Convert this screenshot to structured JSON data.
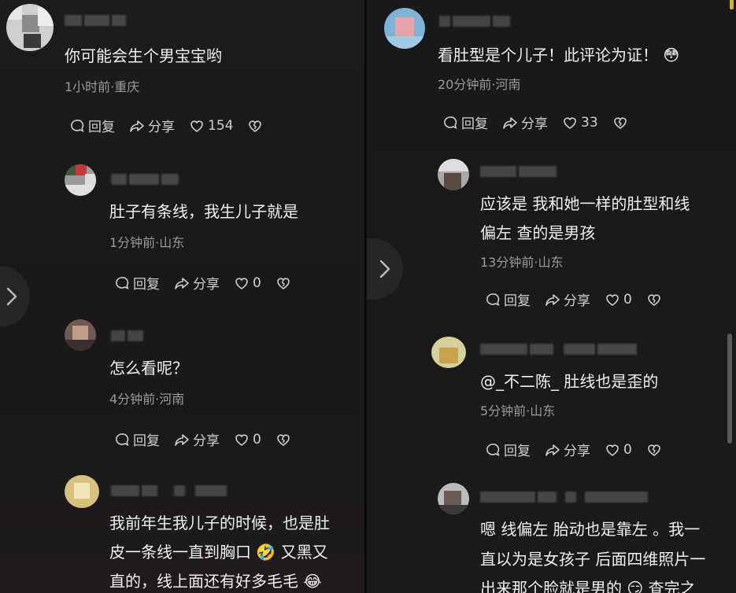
{
  "left": {
    "comments": [
      {
        "text_lines": [
          "你可能会生个男宝宝哟"
        ],
        "meta": "1小时前·重庆",
        "reply": "回复",
        "share": "分享",
        "likes": "154"
      },
      {
        "text_lines": [
          "肚子有条线，我生儿子就是"
        ],
        "meta": "1分钟前·山东",
        "reply": "回复",
        "share": "分享",
        "likes": "0"
      },
      {
        "text_lines": [
          "怎么看呢？"
        ],
        "meta": "4分钟前·河南",
        "reply": "回复",
        "share": "分享",
        "likes": "0"
      },
      {
        "text_lines": [
          "我前年生我儿子的时候，也是肚",
          "皮一条线一直到胸口 🤣 又黑又",
          "直的，线上面还有好多毛毛 😂"
        ]
      }
    ]
  },
  "right": {
    "comments": [
      {
        "text_lines": [
          "看肚型是个儿子！此评论为证！ 😳"
        ],
        "meta": "20分钟前·河南",
        "reply": "回复",
        "share": "分享",
        "likes": "33"
      },
      {
        "text_lines": [
          "应该是 我和她一样的肚型和线",
          "偏左 查的是男孩"
        ],
        "meta": "13分钟前·山东",
        "reply": "回复",
        "share": "分享",
        "likes": "0"
      },
      {
        "text_lines": [
          "@_不二陈_ 肚线也是歪的"
        ],
        "meta": "5分钟前·山东",
        "reply": "回复",
        "share": "分享",
        "likes": "0"
      },
      {
        "text_lines": [
          "嗯 线偏左 胎动也是靠左 。我一",
          "直以为是女孩子 后面四维照片一",
          "出来那个脸就是男的 😏 查完之"
        ]
      }
    ]
  },
  "icons": {
    "reply": "comment-bubble-icon",
    "share": "share-arrow-icon",
    "like": "heart-icon",
    "dislike": "broken-heart-icon",
    "nav": "chevron-right-icon"
  },
  "colors": {
    "background": "#1a1a1a",
    "text": "#f0f0f0",
    "meta": "#9a9a9a",
    "action": "#cfcfcf"
  }
}
